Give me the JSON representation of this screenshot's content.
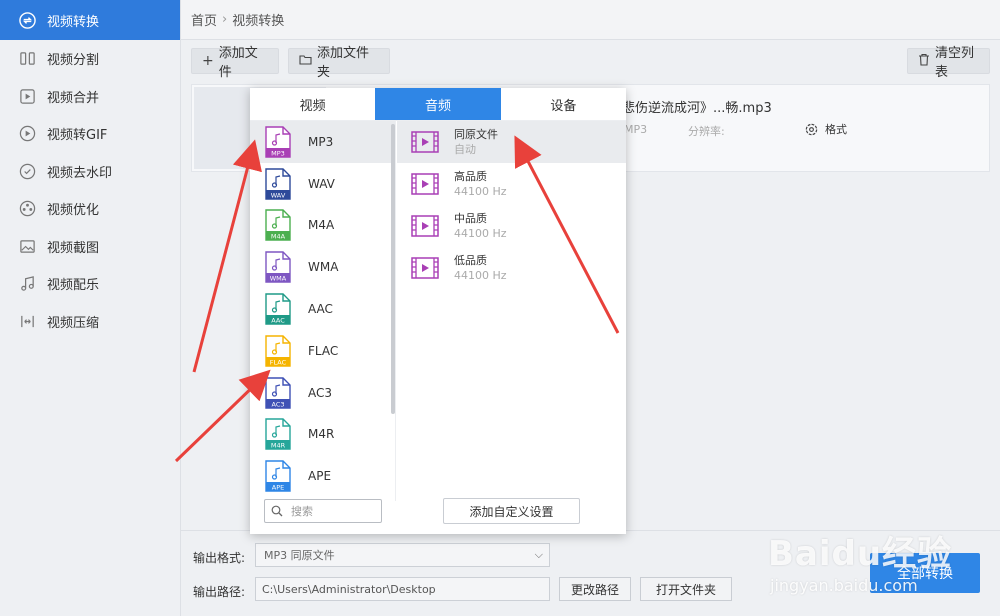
{
  "sidebar": {
    "items": [
      {
        "label": "视频转换",
        "icon": "convert-icon"
      },
      {
        "label": "视频分割",
        "icon": "split-icon"
      },
      {
        "label": "视频合并",
        "icon": "merge-icon"
      },
      {
        "label": "视频转GIF",
        "icon": "gif-icon"
      },
      {
        "label": "视频去水印",
        "icon": "watermark-remove-icon"
      },
      {
        "label": "视频优化",
        "icon": "optimize-icon"
      },
      {
        "label": "视频截图",
        "icon": "screenshot-icon"
      },
      {
        "label": "视频配乐",
        "icon": "music-icon"
      },
      {
        "label": "视频压缩",
        "icon": "compress-icon"
      }
    ]
  },
  "breadcrumb": {
    "home": "首页",
    "current": "视频转换"
  },
  "toolbar": {
    "add_file": "添加文件",
    "add_folder": "添加文件夹",
    "clear_list": "清空列表"
  },
  "file": {
    "name": "悲伤逆流成河》...畅.mp3",
    "format": "MP3",
    "resolution_label": "分辨率:",
    "format_button": "格式"
  },
  "popup": {
    "tabs": [
      "视频",
      "音频",
      "设备"
    ],
    "formats": [
      {
        "name": "MP3",
        "color": "#a93fb5"
      },
      {
        "name": "WAV",
        "color": "#2e4a9a"
      },
      {
        "name": "M4A",
        "color": "#4caf50"
      },
      {
        "name": "WMA",
        "color": "#7e57c2"
      },
      {
        "name": "AAC",
        "color": "#1f9a87"
      },
      {
        "name": "FLAC",
        "color": "#f5b400"
      },
      {
        "name": "AC3",
        "color": "#3f51b5"
      },
      {
        "name": "M4R",
        "color": "#26a69a"
      },
      {
        "name": "APE",
        "color": "#2f86e6"
      }
    ],
    "qualities": [
      {
        "title": "同原文件",
        "sub": "自动"
      },
      {
        "title": "高品质",
        "sub": "44100 Hz"
      },
      {
        "title": "中品质",
        "sub": "44100 Hz"
      },
      {
        "title": "低品质",
        "sub": "44100 Hz"
      }
    ],
    "search_placeholder": "搜索",
    "custom_button": "添加自定义设置"
  },
  "bottom": {
    "output_format_label": "输出格式:",
    "output_format_value": "MP3  同原文件",
    "output_path_label": "输出路径:",
    "output_path_value": "C:\\Users\\Administrator\\Desktop",
    "change_path": "更改路径",
    "open_folder": "打开文件夹",
    "convert_all": "全部转换"
  },
  "watermark": {
    "big": "Baidu经验",
    "small": "jingyan.baidu.com"
  },
  "colors": {
    "accent": "#2f86e6",
    "sidebar_active": "#2f7bdc",
    "arrow": "#e8413b",
    "quality_icon": "#a93fb5"
  }
}
